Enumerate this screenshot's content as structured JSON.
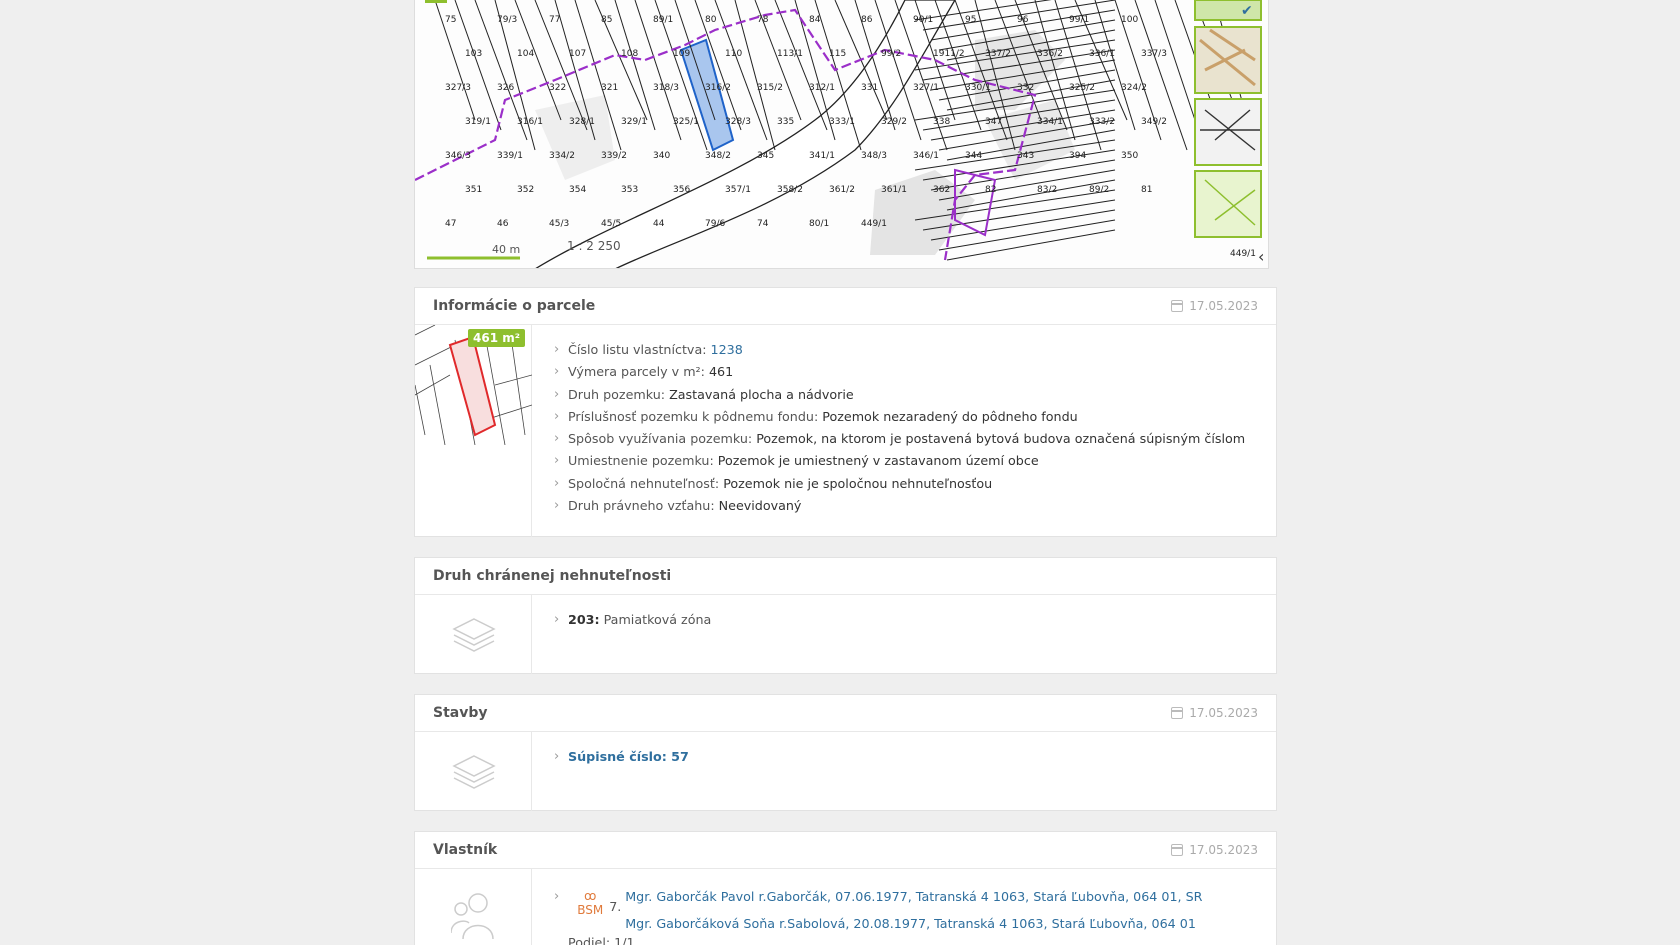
{
  "map": {
    "scale_label": "1 : 2 250",
    "distance_label": "40 m",
    "parcel_labels": [
      "75",
      "79/3",
      "77",
      "85",
      "89/1",
      "80",
      "78",
      "84",
      "86",
      "90/1",
      "95",
      "96",
      "99/1",
      "100",
      "103",
      "104",
      "107",
      "108",
      "109",
      "110",
      "113/1",
      "115",
      "99/2",
      "1911/2",
      "337/2",
      "336/2",
      "336/1",
      "337/3",
      "327/3",
      "326",
      "322",
      "321",
      "318/3",
      "316/2",
      "315/2",
      "312/1",
      "331",
      "327/1",
      "330/1",
      "332",
      "325/2",
      "324/2",
      "319/1",
      "316/1",
      "328/1",
      "329/1",
      "325/1",
      "328/3",
      "335",
      "333/1",
      "329/2",
      "338",
      "347",
      "334/1",
      "333/2",
      "349/2",
      "346/3",
      "339/1",
      "334/2",
      "339/2",
      "340",
      "348/2",
      "345",
      "341/1",
      "348/3",
      "346/1",
      "344",
      "343",
      "394",
      "350",
      "351",
      "352",
      "354",
      "353",
      "356",
      "357/1",
      "358/2",
      "361/2",
      "361/1",
      "362",
      "82",
      "83/2",
      "89/2",
      "81",
      "47",
      "46",
      "45/3",
      "45/5",
      "44",
      "79/6",
      "74",
      "80/1",
      "449/1"
    ]
  },
  "parcel_info": {
    "title": "Informácie o parcele",
    "date": "17.05.2023",
    "area_badge": "461 m²",
    "items": [
      {
        "label": "Číslo listu vlastníctva: ",
        "value": "1238"
      },
      {
        "label": "Výmera parcely v m²: ",
        "value": "461"
      },
      {
        "label": "Druh pozemku: ",
        "value": "Zastavaná plocha a nádvorie"
      },
      {
        "label": "Príslušnosť pozemku k pôdnemu fondu: ",
        "value": "Pozemok nezaradený do pôdneho fondu"
      },
      {
        "label": "Spôsob využívania pozemku: ",
        "value": "Pozemok, na ktorom je postavená bytová budova označená súpisným číslom"
      },
      {
        "label": "Umiestnenie pozemku: ",
        "value": "Pozemok je umiestnený v zastavanom území obce"
      },
      {
        "label": "Spoločná nehnuteľnosť: ",
        "value": "Pozemok nie je spoločnou nehnuteľnosťou"
      },
      {
        "label": "Druh právneho vzťahu: ",
        "value": "Neevidovaný"
      }
    ]
  },
  "protected": {
    "title": "Druh chránenej nehnuteľnosti",
    "code": "203:",
    "label": " Pamiatková zóna"
  },
  "buildings": {
    "title": "Stavby",
    "date": "17.05.2023",
    "item": "Súpisné číslo: 57"
  },
  "owner": {
    "title": "Vlastník",
    "date": "17.05.2023",
    "bsm_label": "BSM",
    "bsm_symbol": "ꝏ",
    "number": "7.",
    "owners": [
      "Mgr. Gaborčák Pavol r.Gaborčák, 07.06.1977, Tatranská 4 1063, Stará Ľubovňa, 064 01, SR",
      "Mgr. Gaborčáková Soňa r.Sabolová, 20.08.1977, Tatranská 4 1063, Stará Ľubovňa, 064 01"
    ],
    "share": "Podiel: 1/1"
  }
}
